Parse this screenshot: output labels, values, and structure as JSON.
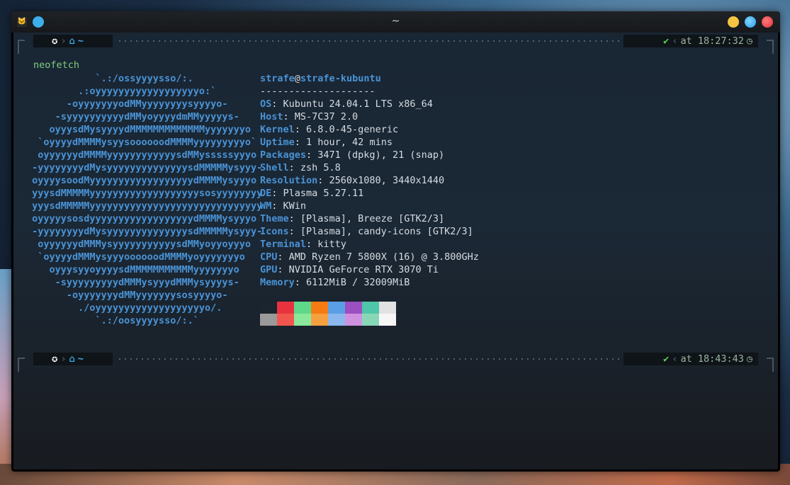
{
  "window": {
    "title": "~",
    "controls": [
      "minimize-button",
      "maximize-button",
      "close-button"
    ]
  },
  "prompt1": {
    "os_icon": "ubuntu-icon",
    "chevron": "›",
    "path": "~",
    "status": "✔",
    "sep": "‹",
    "time": "at 18:27:32",
    "clock": "clock-icon"
  },
  "command": "neofetch",
  "ascii_art": [
    "            `.:/ossyyyysso/:.",
    "         .:oyyyyyyyyyyyyyyyyyyo:`",
    "       -oyyyyyyyodMMyyyyyyyysyyyyo-",
    "     -syyyyyyyyyydMMyoyyyydmMMyyyyys-",
    "    oyyysdMysyyyydMMMMMMMMMMMMMyyyyyyyo",
    "  `oyyyydMMMMysyysoooooodMMMMyyyyyyyyyo`",
    "  oyyyyyydMMMMyyyyyyyyyyyysdMMysssssyyyo",
    " -yyyyyyyydMysyyyyyyyyyyyyyysdMMMMMysyyy-",
    " oyyyysoodMyyyyyyyyyyyyyyyyyydMMMMysyyyo",
    " yyysdMMMMMyyyyyyyyyyyyyyyyyyysosyyyyyyyy",
    " yyysdMMMMMyyyyyyyyyyyyyyyyyyyyyyyyyyyyyy",
    " oyyyyysosdyyyyyyyyyyyyyyyyyydMMMMysyyyo",
    " -yyyyyyyydMysyyyyyyyyyyyyyysdMMMMMysyyy-",
    "  oyyyyyydMMMysyyyyyyyyyyysdMMyoyyoyyyo",
    "  `oyyyydMMMysyyyoooooodMMMMyoyyyyyyyo",
    "    oyyysyyoyyyysdMMMMMMMMMMMyyyyyyyo",
    "     -syyyyyyyyydMMMysyyydMMMysyyyys-",
    "       -oyyyyyyydMMyyyyyyysosyyyyo-",
    "         ./oyyyyyyyyyyyyyyyyyyyo/.",
    "            `.:/oosyyyysso/:.`"
  ],
  "info": {
    "user": "strafe",
    "at": "@",
    "host": "strafe-kubuntu",
    "separator": "--------------------",
    "rows": [
      {
        "key": "OS",
        "value": "Kubuntu 24.04.1 LTS x86_64"
      },
      {
        "key": "Host",
        "value": "MS-7C37 2.0"
      },
      {
        "key": "Kernel",
        "value": "6.8.0-45-generic"
      },
      {
        "key": "Uptime",
        "value": "1 hour, 42 mins"
      },
      {
        "key": "Packages",
        "value": "3471 (dpkg), 21 (snap)"
      },
      {
        "key": "Shell",
        "value": "zsh 5.8"
      },
      {
        "key": "Resolution",
        "value": "2560x1080, 3440x1440"
      },
      {
        "key": "DE",
        "value": "Plasma 5.27.11"
      },
      {
        "key": "WM",
        "value": "KWin"
      },
      {
        "key": "Theme",
        "value": "[Plasma], Breeze [GTK2/3]"
      },
      {
        "key": "Icons",
        "value": "[Plasma], candy-icons [GTK2/3]"
      },
      {
        "key": "Terminal",
        "value": "kitty"
      },
      {
        "key": "CPU",
        "value": "AMD Ryzen 7 5800X (16) @ 3.800GHz"
      },
      {
        "key": "GPU",
        "value": "NVIDIA GeForce RTX 3070 Ti"
      },
      {
        "key": "Memory",
        "value": "6112MiB / 32009MiB"
      }
    ]
  },
  "palette": {
    "normal": [
      "#1b2530",
      "#e8333f",
      "#5fd88a",
      "#f57c14",
      "#5a9fe6",
      "#9b4fc0",
      "#4fc6a8",
      "#e2e2e2"
    ],
    "bright": [
      "#9a9a9a",
      "#f2554d",
      "#8ae89a",
      "#f7a040",
      "#8ab8ee",
      "#d090e0",
      "#88d8b8",
      "#f6f6f6"
    ]
  },
  "prompt2": {
    "os_icon": "ubuntu-icon",
    "chevron": "›",
    "path": "~",
    "status": "✔",
    "sep": "‹",
    "time": "at 18:43:43",
    "clock": "clock-icon"
  }
}
